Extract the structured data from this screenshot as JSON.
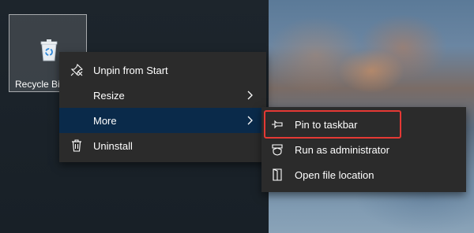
{
  "desktop": {
    "recycle_bin": {
      "label": "Recycle Bin",
      "icon": "recycle-bin-icon"
    }
  },
  "context_menu": {
    "items": [
      {
        "label": "Unpin from Start",
        "icon": "unpin-icon"
      },
      {
        "label": "Resize",
        "icon": "",
        "has_submenu": true
      },
      {
        "label": "More",
        "icon": "",
        "has_submenu": true,
        "active": true
      },
      {
        "label": "Uninstall",
        "icon": "trash-icon"
      }
    ]
  },
  "more_submenu": {
    "items": [
      {
        "label": "Pin to taskbar",
        "icon": "pin-icon",
        "highlighted": true
      },
      {
        "label": "Run as administrator",
        "icon": "shield-icon"
      },
      {
        "label": "Open file location",
        "icon": "file-location-icon"
      }
    ]
  },
  "colors": {
    "menu_bg": "#2b2b2b",
    "active_item_bg": "#0a2a4a",
    "highlight_border": "#e53935"
  }
}
